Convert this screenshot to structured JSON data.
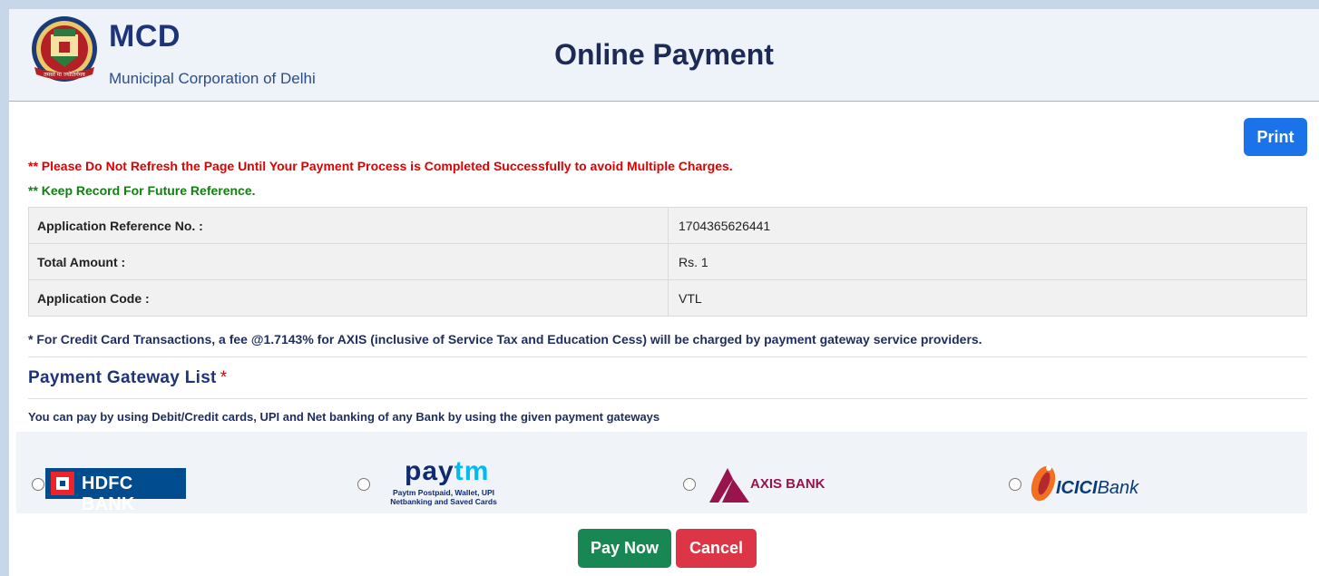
{
  "header": {
    "brand": "MCD",
    "brand_sub": "Municipal Corporation of Delhi",
    "title": "Online Payment",
    "logo_text": "तमसो मा ज्योतिर्गमय"
  },
  "toolbar": {
    "print_label": "Print"
  },
  "notices": {
    "refresh_warning": "** Please Do Not Refresh the Page Until Your Payment Process is Completed Successfully to avoid Multiple Charges.",
    "keep_record": "** Keep Record For Future Reference."
  },
  "details": [
    {
      "label": "Application Reference No. :",
      "value": "1704365626441"
    },
    {
      "label": "Total Amount :",
      "value": "Rs. 1"
    },
    {
      "label": "Application Code :",
      "value": "VTL"
    }
  ],
  "fee_note": "* For Credit Card Transactions, a fee @1.7143% for AXIS (inclusive of Service Tax and Education Cess) will be charged by payment gateway service providers.",
  "gateway": {
    "title": "Payment Gateway List",
    "required_mark": "*",
    "description": "You can pay by using Debit/Credit cards, UPI and Net banking of any Bank by using the given payment gateways",
    "options": {
      "hdfc": {
        "label": "HDFC BANK"
      },
      "paytm": {
        "pay": "pay",
        "tm": "tm",
        "sub1": "Paytm Postpaid, Wallet, UPI",
        "sub2": "Netbanking and Saved Cards"
      },
      "axis": {
        "label": "AXIS BANK"
      },
      "icici": {
        "brand": "ICICI",
        "bank": "Bank"
      }
    }
  },
  "actions": {
    "pay_now": "Pay Now",
    "cancel": "Cancel"
  },
  "colors": {
    "brand_navy": "#1e3477",
    "print_blue": "#1a73e8",
    "warning_red": "#e00000",
    "record_green": "#108010",
    "pay_green": "#198754",
    "cancel_red": "#dc3545",
    "hdfc_blue": "#004c8f",
    "axis_maroon": "#97144d",
    "icici_orange": "#f37021"
  }
}
